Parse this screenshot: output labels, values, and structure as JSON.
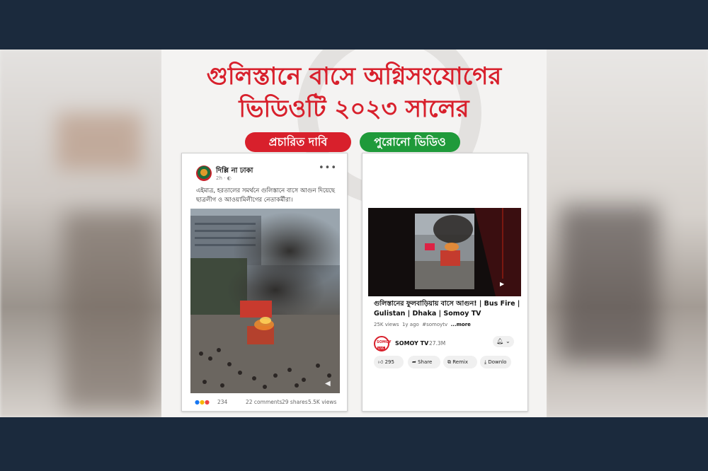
{
  "headline": {
    "line1": "গুলিস্তানে বাসে অগ্নিসংযোগের",
    "line2": "ভিডিওটি ২০২৩ সালের"
  },
  "labels": {
    "claim": "প্রচারিত দাবি",
    "old_video": "পুরোনো ভিডিও"
  },
  "facebook_post": {
    "page_name": "দিল্লি না ঢাকা",
    "time": "2h · ◐",
    "more_icon": "more-dots-icon",
    "caption": "এইমাত্র, হরতালের সমর্থনে গুলিস্তানে বাসে আগুন দিয়েছে ছাত্রলীগ ও আওয়ামিলীগের নেতাকর্মীরা।",
    "reaction_count": "234",
    "comments": "22 comments",
    "shares": "29 shares",
    "views": "5.5K views"
  },
  "youtube_video": {
    "title": "গুলিস্তানের ফুলবাড়িয়ায় বাসে আগুন! | Bus Fire | Gulistan | Dhaka | Somoy TV",
    "views": "25K views",
    "age": "1y ago",
    "hashtag": "#somoytv",
    "more": "...more",
    "channel_name": "SOMOY TV",
    "subscribers": "27.3M",
    "logo_text": "SOMOY",
    "logo_live": "LIVE",
    "likes": "295",
    "share_label": "Share",
    "remix_label": "Remix",
    "download_label": "Downlo"
  },
  "colors": {
    "headline_red": "#d8202c",
    "claim_red": "#d8202c",
    "old_green": "#1f9a3a",
    "frame_navy": "#1b2a3d"
  }
}
